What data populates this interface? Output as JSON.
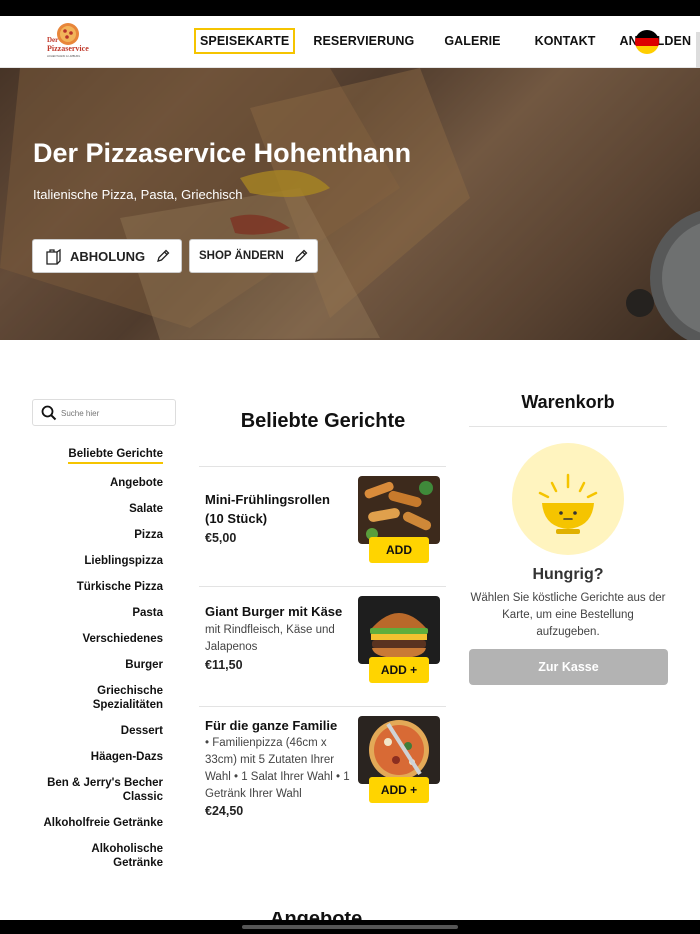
{
  "brand": {
    "logo_text_line1": "Der",
    "logo_text_line2": "Pizzaservice",
    "logo_text_line3": "HOHENTHANN & LIMBURG"
  },
  "nav": {
    "items": [
      {
        "label": "SPEISEKARTE"
      },
      {
        "label": "RESERVIERUNG"
      },
      {
        "label": "GALERIE"
      },
      {
        "label": "KONTAKT"
      },
      {
        "label": "ANMELDEN"
      }
    ],
    "language": "german-flag-icon"
  },
  "hero": {
    "title": "Der Pizzaservice Hohenthann",
    "subtitle": "Italienische Pizza, Pasta, Griechisch",
    "pickup_label": "ABHOLUNG",
    "change_shop_label": "SHOP ÄNDERN"
  },
  "search": {
    "placeholder": "Suche hier"
  },
  "categories": [
    "Beliebte Gerichte",
    "Angebote",
    "Salate",
    "Pizza",
    "Lieblingspizza",
    "Türkische Pizza",
    "Pasta",
    "Verschiedenes",
    "Burger",
    "Griechische Spezialitäten",
    "Dessert",
    "Häagen-Dazs",
    "Ben & Jerry's Becher Classic",
    "Alkoholfreie Getränke",
    "Alkoholische Getränke"
  ],
  "menu": {
    "section_title": "Beliebte Gerichte",
    "items": [
      {
        "name": "Mini-Frühlingsrollen (10 Stück)",
        "description": "",
        "price": "€5,00",
        "button": "ADD"
      },
      {
        "name": "Giant Burger mit Käse",
        "description": "mit Rindfleisch, Käse und Jalapenos",
        "price": "€11,50",
        "button": "ADD +"
      },
      {
        "name": "Für die ganze Familie",
        "description": "• Familienpizza (46cm x 33cm) mit 5 Zutaten Ihrer Wahl • 1 Salat Ihrer Wahl • 1 Getränk Ihrer Wahl",
        "price": "€24,50",
        "button": "ADD +"
      }
    ],
    "next_section_title": "Angebote"
  },
  "cart": {
    "title": "Warenkorb",
    "empty_title": "Hungrig?",
    "empty_text": "Wählen Sie köstliche Gerichte aus der Karte, um eine Bestellung aufzugeben.",
    "checkout_label": "Zur Kasse"
  },
  "colors": {
    "accent": "#ffd400",
    "nav_highlight": "#f5c400",
    "checkout_disabled": "#b3b3b3"
  }
}
